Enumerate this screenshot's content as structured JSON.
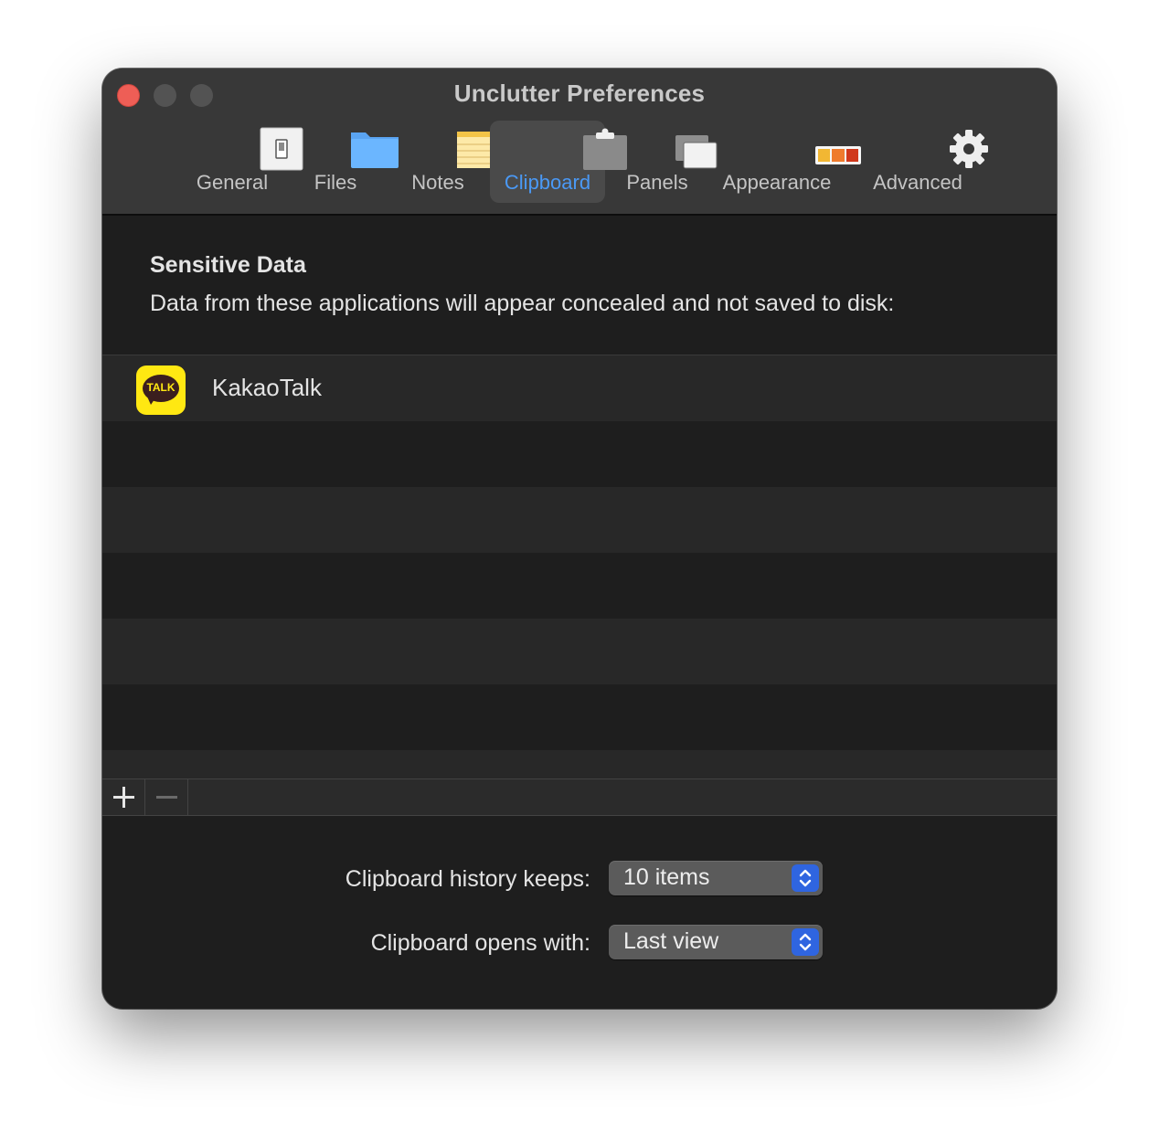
{
  "window": {
    "title": "Unclutter Preferences"
  },
  "toolbar": {
    "tabs": [
      {
        "label": "General",
        "icon": "switch-icon"
      },
      {
        "label": "Files",
        "icon": "folder-icon"
      },
      {
        "label": "Notes",
        "icon": "notepad-icon"
      },
      {
        "label": "Clipboard",
        "icon": "clipboard-icon",
        "active": true
      },
      {
        "label": "Panels",
        "icon": "panels-icon"
      },
      {
        "label": "Appearance",
        "icon": "palette-icon"
      },
      {
        "label": "Advanced",
        "icon": "gear-icon"
      }
    ]
  },
  "sensitive": {
    "title": "Sensitive Data",
    "description": "Data from these applications will appear concealed and not saved to disk:",
    "apps": [
      {
        "name": "KakaoTalk",
        "icon_text": "TALK",
        "icon": "kakaotalk-icon"
      }
    ]
  },
  "list_controls": {
    "add": "add-button",
    "remove": "remove-button"
  },
  "settings": {
    "history_label": "Clipboard history keeps:",
    "history_value": "10 items",
    "opens_label": "Clipboard opens with:",
    "opens_value": "Last view"
  },
  "colors": {
    "accent": "#4a99f5",
    "close": "#ee5e56",
    "kakao_yellow": "#ffe812",
    "stepper_blue": "#2f65e0"
  }
}
